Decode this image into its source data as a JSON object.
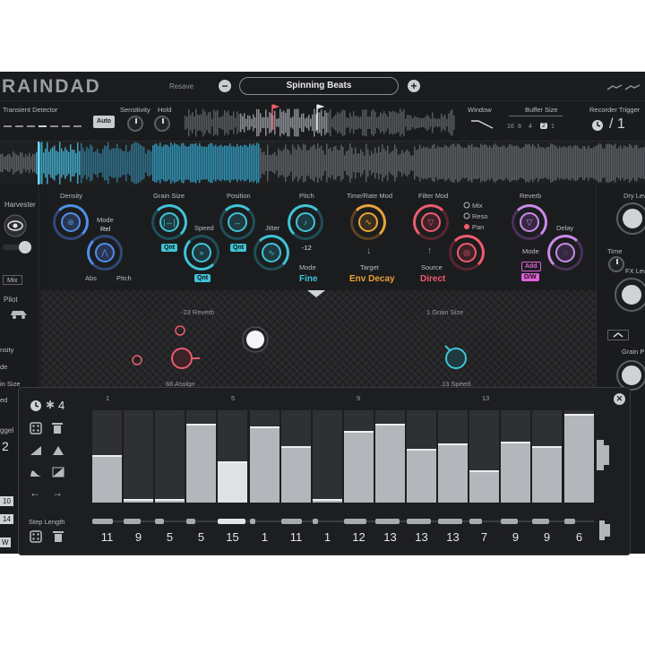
{
  "app": {
    "title": "RAINDAD"
  },
  "header": {
    "resave_label": "Resave",
    "preset_name": "Spinning Beats",
    "prev_glyph": "−",
    "next_glyph": "+"
  },
  "transient": {
    "label": "Transient Detector",
    "auto_label": "Auto",
    "sensitivity_label": "Sensitivity",
    "hold_label": "Hold"
  },
  "window": {
    "label": "Window"
  },
  "buffer": {
    "label": "Buffer Size",
    "sizes": [
      "16",
      "8",
      "4",
      "2",
      "1"
    ],
    "selected": "2",
    "sizes_bottom": [
      "3",
      "2",
      "1"
    ]
  },
  "recorder": {
    "label": "Recorder Trigger",
    "value": "/ 1"
  },
  "left_panel": {
    "harvester": "Harvester",
    "mix": "Mix",
    "pilot": "Pilot",
    "density": "nsity",
    "rate": "de",
    "grain": "in Size",
    "speed": "ed",
    "trigger": "ggel",
    "trigger_value": "2",
    "steps": [
      "10",
      "14"
    ],
    "w": "W"
  },
  "right_panel": {
    "dry_level": "Dry Lev",
    "time": "Time",
    "fx_level": "FX Lev",
    "grain_pitch": "Grain P",
    "decay": "ay",
    "delay": "ay"
  },
  "controls": {
    "density": {
      "label": "Density"
    },
    "mode": {
      "label": "Mode",
      "value": "Rel"
    },
    "abs_label": "Abs",
    "pitch_small": "Pitch",
    "grain_size": {
      "label": "Grain Size",
      "qnt": "Qnt"
    },
    "speed": {
      "label": "Speed",
      "qnt": "Qnt"
    },
    "position": {
      "label": "Position",
      "qnt": "Qnt"
    },
    "jitter": {
      "label": "Jitter"
    },
    "pitch": {
      "label": "Pitch",
      "value": "-12",
      "mode_label": "Mode",
      "mode_value": "Fine"
    },
    "time_rate": {
      "label": "Time/Rate Mod",
      "target_label": "Target",
      "target_value": "Env Decay"
    },
    "filter": {
      "label": "Filter Mod",
      "source_label": "Source",
      "source_value": "Direct",
      "options": [
        "Mix",
        "Reso",
        "Pan"
      ]
    },
    "reverb": {
      "label": "Reverb",
      "delay_label": "Delay",
      "mode_label": "Mode",
      "add_label": "Add",
      "dw_label": "D/W"
    }
  },
  "grain_field": {
    "reverb_assign": "-23  Reverb",
    "assign": "66  Assign",
    "grain_size": "1   Grain Size",
    "speed": "13  Speed"
  },
  "sequencer": {
    "star_count": "4",
    "step_markers": [
      "1",
      "5",
      "9",
      "13"
    ],
    "step_length_label": "Step Length",
    "steps": [
      {
        "level": 0.51,
        "length": "11"
      },
      {
        "level": 0.04,
        "length": "9"
      },
      {
        "level": 0.04,
        "length": "5"
      },
      {
        "level": 0.85,
        "length": "5"
      },
      {
        "level": 0.45,
        "length": "15",
        "highlight": true
      },
      {
        "level": 0.83,
        "length": "1"
      },
      {
        "level": 0.61,
        "length": "11"
      },
      {
        "level": 0.04,
        "length": "1"
      },
      {
        "level": 0.78,
        "length": "12"
      },
      {
        "level": 0.85,
        "length": "13"
      },
      {
        "level": 0.58,
        "length": "13"
      },
      {
        "level": 0.64,
        "length": "13"
      },
      {
        "level": 0.35,
        "length": "7"
      },
      {
        "level": 0.66,
        "length": "9"
      },
      {
        "level": 0.61,
        "length": "9"
      },
      {
        "level": 0.96,
        "length": "6"
      }
    ]
  },
  "colors": {
    "blue": "#4f8fe8",
    "cyan": "#3fc4d8",
    "orange": "#e8a23a",
    "pink": "#ef5b6e",
    "violet": "#c98be8",
    "magenta": "#e060d8"
  }
}
